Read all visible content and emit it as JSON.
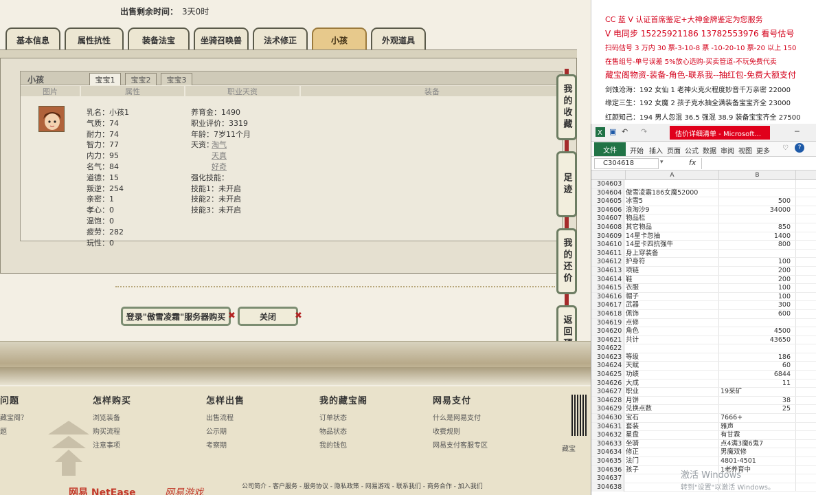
{
  "game": {
    "sale_time_label": "出售剩余时间：",
    "sale_time_value": "3天0时",
    "tabs": [
      "基本信息",
      "属性抗性",
      "装备法宝",
      "坐骑召唤兽",
      "法术修正",
      "小孩",
      "外观道具"
    ],
    "active_tab": "小孩",
    "panel_title": "小孩",
    "subtabs": [
      "宝宝1",
      "宝宝2",
      "宝宝3"
    ],
    "columns": [
      "图片",
      "属性",
      "职业天资",
      "装备"
    ],
    "attributes": [
      "乳名：小孩1",
      "气质：74",
      "耐力：74",
      "智力：77",
      "内力：95",
      "名气：84",
      "道德：15",
      "叛逆：254",
      "亲密：1",
      "孝心：0",
      "温饱：0",
      "疲劳：282",
      "玩性：0"
    ],
    "career": {
      "rows": [
        "养育金：1490",
        "职业评价：3319",
        "年龄：7岁11个月"
      ],
      "talent_label": "天资：",
      "talents": [
        "淘气",
        "天真",
        "好奇"
      ],
      "skills_label": "强化技能：",
      "skills": [
        "技能1：未开启",
        "技能2：未开启",
        "技能3：未开启"
      ]
    },
    "side_buttons": [
      "我的收藏",
      "足迹",
      "我的还价",
      "返回顶部"
    ],
    "login_button": "登录\"傲雪凌霜\"服务器购买",
    "close_button": "关闭",
    "footer": {
      "columns": [
        {
          "title": "问题",
          "links": [
            "藏宝阁？",
            "题"
          ]
        },
        {
          "title": "怎样购买",
          "links": [
            "浏览装备",
            "购买流程",
            "注意事项"
          ]
        },
        {
          "title": "怎样出售",
          "links": [
            "出售流程",
            "公示期",
            "考察期"
          ]
        },
        {
          "title": "我的藏宝阁",
          "links": [
            "订单状态",
            "物品状态",
            "我的钱包"
          ]
        },
        {
          "title": "网易支付",
          "links": [
            "什么是网易支付",
            "收费规则",
            "网易支付客服专区"
          ]
        }
      ],
      "qr_label": "藏宝",
      "bottom_links": "公司简介 - 客户服务 - 服务协议 - 隐私政策 - 网易游戏 - 联系我们 - 商务合作 - 加入我们",
      "logo1": "网易 NetEase",
      "logo2": "网易游戏"
    }
  },
  "doc": {
    "lines": [
      {
        "text": "CC 蓝 V 认证首席鉴定+大神金牌鉴定为您服务",
        "color": "#d4001a"
      },
      {
        "text": "V 电同步 15225921186 13782553976 看号估号",
        "color": "#d4001a"
      },
      {
        "text": "扫码估号 3 万内 30 票-3-10-8 票 -10-20-10 票-20 以上 150",
        "color": "#d4001a"
      },
      {
        "text": "在售组号-单号误差 5%放心选购-买卖管道-不玩免费代卖",
        "color": "#d4001a"
      },
      {
        "text": "藏宝阁物资-装备-角色-联系我--抽红包-免费大额支付",
        "color": "#d4001a"
      },
      {
        "text": "剑蚀沧海：192 女仙 1 老神火克火程度妙音千万亲密 22000",
        "color": "#222"
      },
      {
        "text": "缘定三生：192 女魔 2 孩子克水抽全满装备宝宝齐全 23000",
        "color": "#222"
      },
      {
        "text": "红颜知己：194 男人忽混 36.5 强混 38.9 装备宝宝齐全 27500",
        "color": "#222"
      }
    ]
  },
  "excel": {
    "title": "估价详细清单 - Microsoft...",
    "file_tab": "文件",
    "ribbon_tabs": [
      "开始",
      "插入",
      "页面",
      "公式",
      "数据",
      "审阅",
      "视图",
      "更多"
    ],
    "name_box": "C304618",
    "fx": "fx",
    "columns": [
      "A",
      "B"
    ],
    "rows": [
      {
        "n": "304603",
        "a": "",
        "b": ""
      },
      {
        "n": "304604",
        "a": "傲雪凌霜186女魔52000",
        "b": ""
      },
      {
        "n": "304605",
        "a": "冰雪5",
        "b": "500"
      },
      {
        "n": "304606",
        "a": "浪淘沙9",
        "b": "34000"
      },
      {
        "n": "304607",
        "a": "物品栏",
        "b": ""
      },
      {
        "n": "304608",
        "a": "其它物品",
        "b": "850"
      },
      {
        "n": "304609",
        "a": "14星卡忽抽",
        "b": "1400"
      },
      {
        "n": "304610",
        "a": "14星卡四抗强牛",
        "b": "800"
      },
      {
        "n": "304611",
        "a": "身上穿装备",
        "b": ""
      },
      {
        "n": "304612",
        "a": "护身符",
        "b": "100"
      },
      {
        "n": "304613",
        "a": "项链",
        "b": "200"
      },
      {
        "n": "304614",
        "a": "鞋",
        "b": "200"
      },
      {
        "n": "304615",
        "a": "衣服",
        "b": "100"
      },
      {
        "n": "304616",
        "a": "帽子",
        "b": "100"
      },
      {
        "n": "304617",
        "a": "武器",
        "b": "300"
      },
      {
        "n": "304618",
        "a": "佩饰",
        "b": "600"
      },
      {
        "n": "304619",
        "a": "点修",
        "b": ""
      },
      {
        "n": "304620",
        "a": "角色",
        "b": "4500"
      },
      {
        "n": "304621",
        "a": "共计",
        "b": "43650"
      },
      {
        "n": "304622",
        "a": "",
        "b": ""
      },
      {
        "n": "304623",
        "a": "等级",
        "b": "186"
      },
      {
        "n": "304624",
        "a": "天赋",
        "b": "60"
      },
      {
        "n": "304625",
        "a": "功绩",
        "b": "6844"
      },
      {
        "n": "304626",
        "a": "大成",
        "b": "11"
      },
      {
        "n": "304627",
        "a": "职业",
        "b": "",
        "bt": "19采矿"
      },
      {
        "n": "304628",
        "a": "月饼",
        "b": "38"
      },
      {
        "n": "304629",
        "a": "兑换点数",
        "b": "25"
      },
      {
        "n": "304630",
        "a": "宝石",
        "b": "",
        "bt": "7666+"
      },
      {
        "n": "304631",
        "a": "套装",
        "b": "",
        "bt": "雅声"
      },
      {
        "n": "304632",
        "a": "星盘",
        "b": "",
        "bt": "有甘霖"
      },
      {
        "n": "304633",
        "a": "坐骑",
        "b": "",
        "bt": "点4满3魔6鬼7"
      },
      {
        "n": "304634",
        "a": "修正",
        "b": "",
        "bt": "男魔双修"
      },
      {
        "n": "304635",
        "a": "法门",
        "b": "",
        "bt": "4801-4501"
      },
      {
        "n": "304636",
        "a": "孩子",
        "b": "",
        "bt": "1老养育中"
      },
      {
        "n": "304637",
        "a": "",
        "b": ""
      },
      {
        "n": "304638",
        "a": "",
        "b": ""
      }
    ],
    "watermark1": "激活 Windows",
    "watermark2": "转到\"设置\"以激活 Windows。"
  }
}
